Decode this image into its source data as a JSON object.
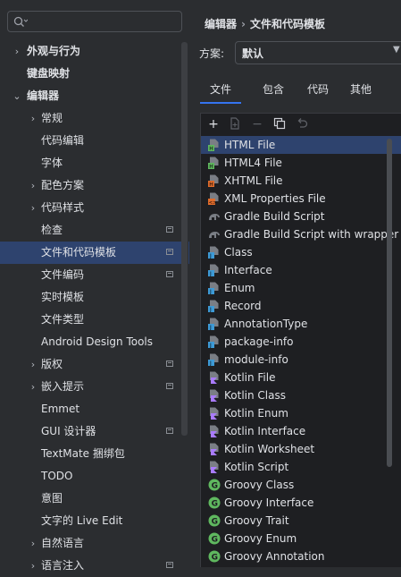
{
  "search": {
    "placeholder": ""
  },
  "tree": {
    "items": [
      {
        "label": "外观与行为",
        "chev": "›",
        "bold": true
      },
      {
        "label": "键盘映射",
        "bold": true
      },
      {
        "label": "编辑器",
        "chev": "⌄",
        "bold": true
      },
      {
        "label": "常规",
        "chev": "›"
      },
      {
        "label": "代码编辑"
      },
      {
        "label": "字体"
      },
      {
        "label": "配色方案",
        "chev": "›"
      },
      {
        "label": "代码样式",
        "chev": "›"
      },
      {
        "label": "检查",
        "badge": true
      },
      {
        "label": "文件和代码模板",
        "badge": true,
        "selected": true
      },
      {
        "label": "文件编码",
        "badge": true
      },
      {
        "label": "实时模板"
      },
      {
        "label": "文件类型"
      },
      {
        "label": "Android Design Tools"
      },
      {
        "label": "版权",
        "chev": "›",
        "badge": true
      },
      {
        "label": "嵌入提示",
        "chev": "›",
        "badge": true
      },
      {
        "label": "Emmet"
      },
      {
        "label": "GUI 设计器",
        "badge": true
      },
      {
        "label": "TextMate 捆绑包"
      },
      {
        "label": "TODO"
      },
      {
        "label": "意图"
      },
      {
        "label": "文字的 Live Edit"
      },
      {
        "label": "自然语言",
        "chev": "›"
      },
      {
        "label": "语言注入",
        "chev": "›",
        "badge": true
      }
    ]
  },
  "breadcrumb": {
    "part1": "编辑器",
    "sep": "›",
    "part2": "文件和代码模板"
  },
  "scheme": {
    "label": "方案:",
    "value": "默认",
    "arrow": "▼"
  },
  "tabs": [
    {
      "label": "文件",
      "active": true
    },
    {
      "label": "包含"
    },
    {
      "label": "代码"
    },
    {
      "label": "其他"
    }
  ],
  "toolbar": {
    "add": "+",
    "remove": "−"
  },
  "colors": {
    "accent": "#3574f0",
    "selection": "#2e436e",
    "kotlin": "#a97bff",
    "groovy": "#5fb85f",
    "java": "#3d9ad6"
  },
  "templates": [
    {
      "name": "HTML File",
      "icon": "html",
      "selected": true
    },
    {
      "name": "HTML4 File",
      "icon": "html"
    },
    {
      "name": "XHTML File",
      "icon": "xhtml"
    },
    {
      "name": "XML Properties File",
      "icon": "xml"
    },
    {
      "name": "Gradle Build Script",
      "icon": "gradle"
    },
    {
      "name": "Gradle Build Script with wrapper",
      "icon": "gradle"
    },
    {
      "name": "Class",
      "icon": "java"
    },
    {
      "name": "Interface",
      "icon": "java"
    },
    {
      "name": "Enum",
      "icon": "java"
    },
    {
      "name": "Record",
      "icon": "java"
    },
    {
      "name": "AnnotationType",
      "icon": "java"
    },
    {
      "name": "package-info",
      "icon": "java"
    },
    {
      "name": "module-info",
      "icon": "java"
    },
    {
      "name": "Kotlin File",
      "icon": "kotlin"
    },
    {
      "name": "Kotlin Class",
      "icon": "kotlin"
    },
    {
      "name": "Kotlin Enum",
      "icon": "kotlin"
    },
    {
      "name": "Kotlin Interface",
      "icon": "kotlin"
    },
    {
      "name": "Kotlin Worksheet",
      "icon": "kotlin"
    },
    {
      "name": "Kotlin Script",
      "icon": "kotlin"
    },
    {
      "name": "Groovy Class",
      "icon": "groovy"
    },
    {
      "name": "Groovy Interface",
      "icon": "groovy"
    },
    {
      "name": "Groovy Trait",
      "icon": "groovy"
    },
    {
      "name": "Groovy Enum",
      "icon": "groovy"
    },
    {
      "name": "Groovy Annotation",
      "icon": "groovy"
    }
  ]
}
